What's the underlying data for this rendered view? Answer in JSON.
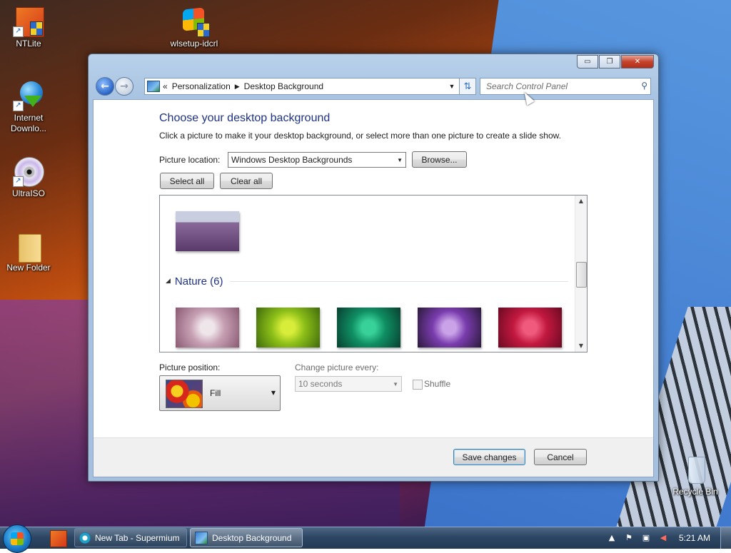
{
  "desktop": {
    "icons": [
      {
        "label": "NTLite"
      },
      {
        "label": "wlsetup-idcrl"
      },
      {
        "label": "Internet Downlo..."
      },
      {
        "label": "UltraISO"
      },
      {
        "label": "New Folder"
      },
      {
        "label": "Recycle Bin"
      }
    ]
  },
  "window": {
    "caption": {
      "minimize": "▭",
      "maximize": "❐",
      "close": "✕"
    },
    "breadcrumb": [
      "Personalization",
      "Desktop Background"
    ],
    "breadcrumb_prefix": "«",
    "search_placeholder": "Search Control Panel",
    "title": "Choose your desktop background",
    "subtitle": "Click a picture to make it your desktop background, or select more than one picture to create a slide show.",
    "picture_location_label": "Picture location:",
    "picture_location_value": "Windows Desktop Backgrounds",
    "browse_label": "Browse...",
    "select_all_label": "Select all",
    "clear_all_label": "Clear all",
    "gallery": {
      "group_name": "Nature (6)",
      "thumbnails": [
        {
          "name": "lavender-field",
          "colors": [
            "#c9cde0",
            "#8a6a9a",
            "#5a3a6a"
          ]
        },
        {
          "name": "dandelion",
          "colors": [
            "#efe6ea",
            "#c7a0b4",
            "#8a5a72"
          ]
        },
        {
          "name": "green-succulent",
          "colors": [
            "#d8ec3a",
            "#8cbf18",
            "#3f6a0c"
          ]
        },
        {
          "name": "green-leaves",
          "colors": [
            "#39d19a",
            "#0f8f63",
            "#083f2f"
          ]
        },
        {
          "name": "purple-thistle",
          "colors": [
            "#c9a2e8",
            "#7a3cae",
            "#2b1a3a"
          ]
        },
        {
          "name": "red-dahlia",
          "colors": [
            "#ef5a7d",
            "#c2183f",
            "#6a0a22"
          ]
        }
      ]
    },
    "picture_position_label": "Picture position:",
    "picture_position_value": "Fill",
    "change_picture_label": "Change picture every:",
    "change_picture_value": "10 seconds",
    "shuffle_label": "Shuffle",
    "save_label": "Save changes",
    "cancel_label": "Cancel"
  },
  "taskbar": {
    "tasks": [
      {
        "label": "New Tab - Supermium",
        "active": false
      },
      {
        "label": "Desktop Background",
        "active": true
      }
    ],
    "clock": "5:21 AM"
  }
}
